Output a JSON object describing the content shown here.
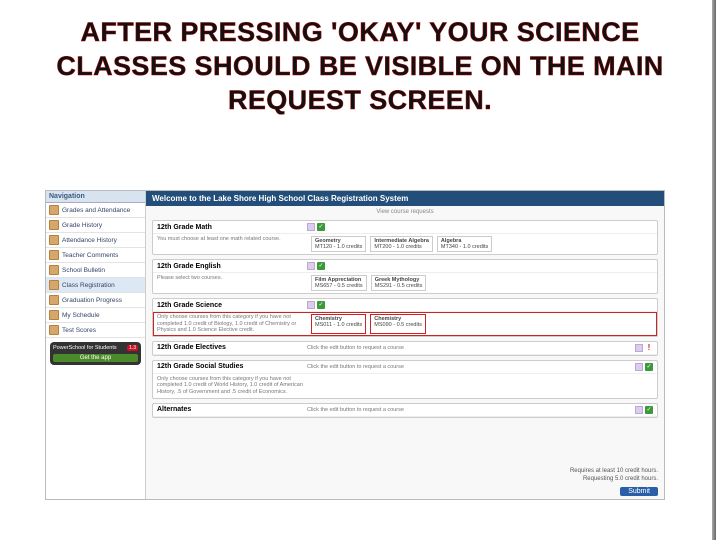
{
  "title": "AFTER PRESSING 'OKAY' YOUR SCIENCE CLASSES SHOULD BE VISIBLE ON THE MAIN REQUEST SCREEN.",
  "nav": {
    "header": "Navigation",
    "items": [
      "Grades and Attendance",
      "Grade History",
      "Attendance History",
      "Teacher Comments",
      "School Bulletin",
      "Class Registration",
      "Graduation Progress",
      "My Schedule",
      "Test Scores"
    ]
  },
  "power": {
    "badge": "1.3",
    "title": "PowerSchool for Students",
    "cta": "Get the app"
  },
  "main": {
    "header": "Welcome to the Lake Shore High School Class Registration System",
    "sub": "View course requests"
  },
  "sections": [
    {
      "title": "12th Grade Math",
      "note": "You must choose at least one math related course.",
      "courses": [
        {
          "name": "Geometry",
          "code": "MT120 - 1.0 credits"
        },
        {
          "name": "Intermediate Algebra",
          "code": "MT200 - 1.0 credits"
        },
        {
          "name": "Algebra",
          "code": "MT340 - 1.0 credits"
        }
      ],
      "status": "ok"
    },
    {
      "title": "12th Grade English",
      "note": "Please select two courses.",
      "courses": [
        {
          "name": "Film Appreciation",
          "code": "MS657 - 0.5 credits"
        },
        {
          "name": "Greek Mythology",
          "code": "MS291 - 0.5 credits"
        }
      ],
      "status": "ok"
    },
    {
      "title": "12th Grade Science",
      "note": "Only choose courses from this category if you have not completed 1.0 credit of Biology, 1.0 credit of Chemistry or Physics and 1.0 Science Elective credit.",
      "courses": [
        {
          "name": "Chemistry",
          "code": "MS011 - 1.0 credits"
        },
        {
          "name": "Chemistry",
          "code": "MS090 - 0.5 credits"
        }
      ],
      "status": "ok",
      "highlight": true
    },
    {
      "title": "12th Grade Electives",
      "editNote": "Click the edit button to request a course",
      "status": "warn"
    },
    {
      "title": "12th Grade Social Studies",
      "note": "Only choose courses from this category if you have not completed 1.0 credit of World History, 1.0 credit of American History, .5 of Government and .5 credit of Economics.",
      "editNote": "Click the edit button to request a course",
      "status": "ok"
    },
    {
      "title": "",
      "alternate": "Alternates",
      "editNote": "Click the edit button to request a course",
      "status": "ok"
    }
  ],
  "footer": {
    "line1": "Requires at least 10 credit hours.",
    "line2": "Requesting 5.0 credit hours.",
    "submit": "Submit"
  }
}
